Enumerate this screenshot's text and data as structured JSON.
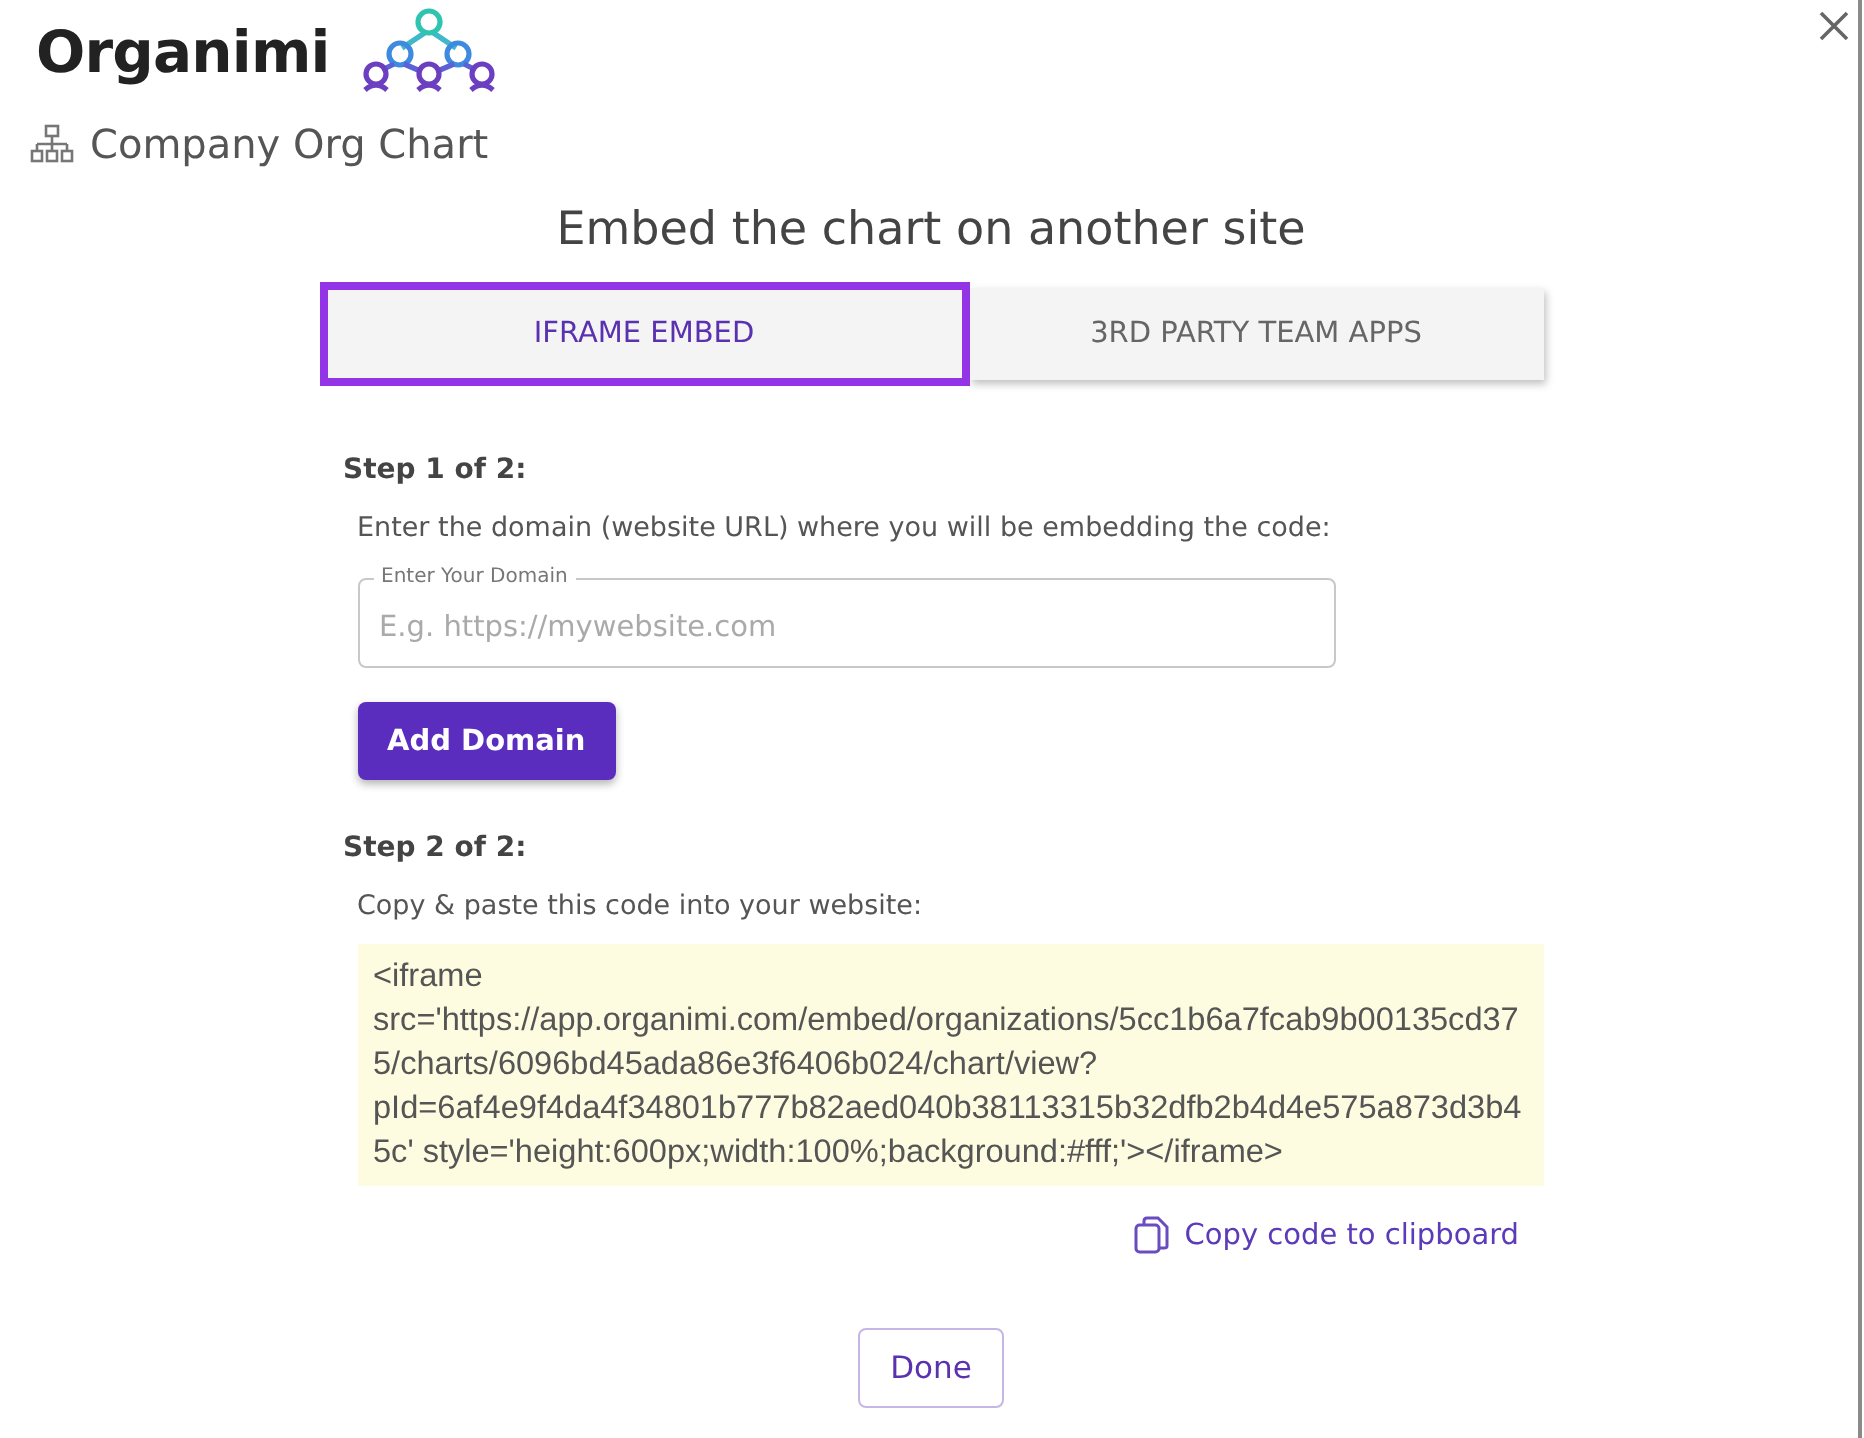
{
  "brand": {
    "wordmark": "Organimi"
  },
  "chart_name": "Company Org Chart",
  "title": "Embed the chart on another site",
  "tabs": [
    {
      "label": "IFRAME EMBED",
      "selected": true
    },
    {
      "label": "3RD PARTY TEAM APPS",
      "selected": false
    }
  ],
  "steps": [
    {
      "kind": "domain",
      "heading": "Step 1 of 2:",
      "instruction": "Enter the domain (website URL) where you will be embedding the code:",
      "field": {
        "label": "Enter Your Domain",
        "placeholder": "E.g. https://mywebsite.com"
      },
      "button": "Add Domain"
    },
    {
      "kind": "code",
      "heading": "Step 2 of 2:",
      "instruction": "Copy & paste this code into your website:",
      "code": "<iframe src='https://app.organimi.com/embed/organizations/5cc1b6a7fcab9b00135cd375/charts/6096bd45ada86e3f6406b024/chart/view?pId=6af4e9f4da4f34801b777b82aed040b38113315b32dfb2b4d4e575a873d3b45c' style='height:600px;width:100%;background:#fff;'></iframe>",
      "copy_link": "Copy code to clipboard"
    }
  ],
  "done_button": "Done"
}
